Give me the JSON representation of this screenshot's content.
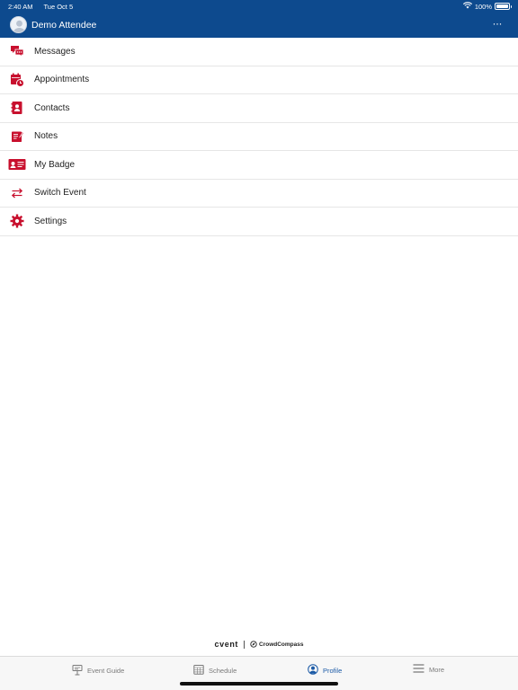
{
  "status_bar": {
    "time": "2:40 AM",
    "date": "Tue Oct 5",
    "battery": "100%"
  },
  "header": {
    "title": "Demo Attendee",
    "more_label": "···"
  },
  "menu": {
    "items": [
      {
        "label": "Messages",
        "icon": "messages-icon"
      },
      {
        "label": "Appointments",
        "icon": "appointments-icon"
      },
      {
        "label": "Contacts",
        "icon": "contacts-icon"
      },
      {
        "label": "Notes",
        "icon": "notes-icon"
      },
      {
        "label": "My Badge",
        "icon": "badge-icon"
      },
      {
        "label": "Switch Event",
        "icon": "switch-event-icon"
      },
      {
        "label": "Settings",
        "icon": "settings-icon"
      }
    ]
  },
  "branding": {
    "cvent": "cvent",
    "crowdcompass": "CrowdCompass"
  },
  "tabbar": {
    "tabs": [
      {
        "label": "Event Guide",
        "icon": "event-guide-icon",
        "active": false
      },
      {
        "label": "Schedule",
        "icon": "schedule-icon",
        "active": false
      },
      {
        "label": "Profile",
        "icon": "profile-icon",
        "active": true
      },
      {
        "label": "More",
        "icon": "hamburger-icon",
        "active": false
      }
    ]
  },
  "colors": {
    "header_bg": "#0d4a8e",
    "icon_red": "#c8102e",
    "active_tab": "#1b5aa6"
  }
}
